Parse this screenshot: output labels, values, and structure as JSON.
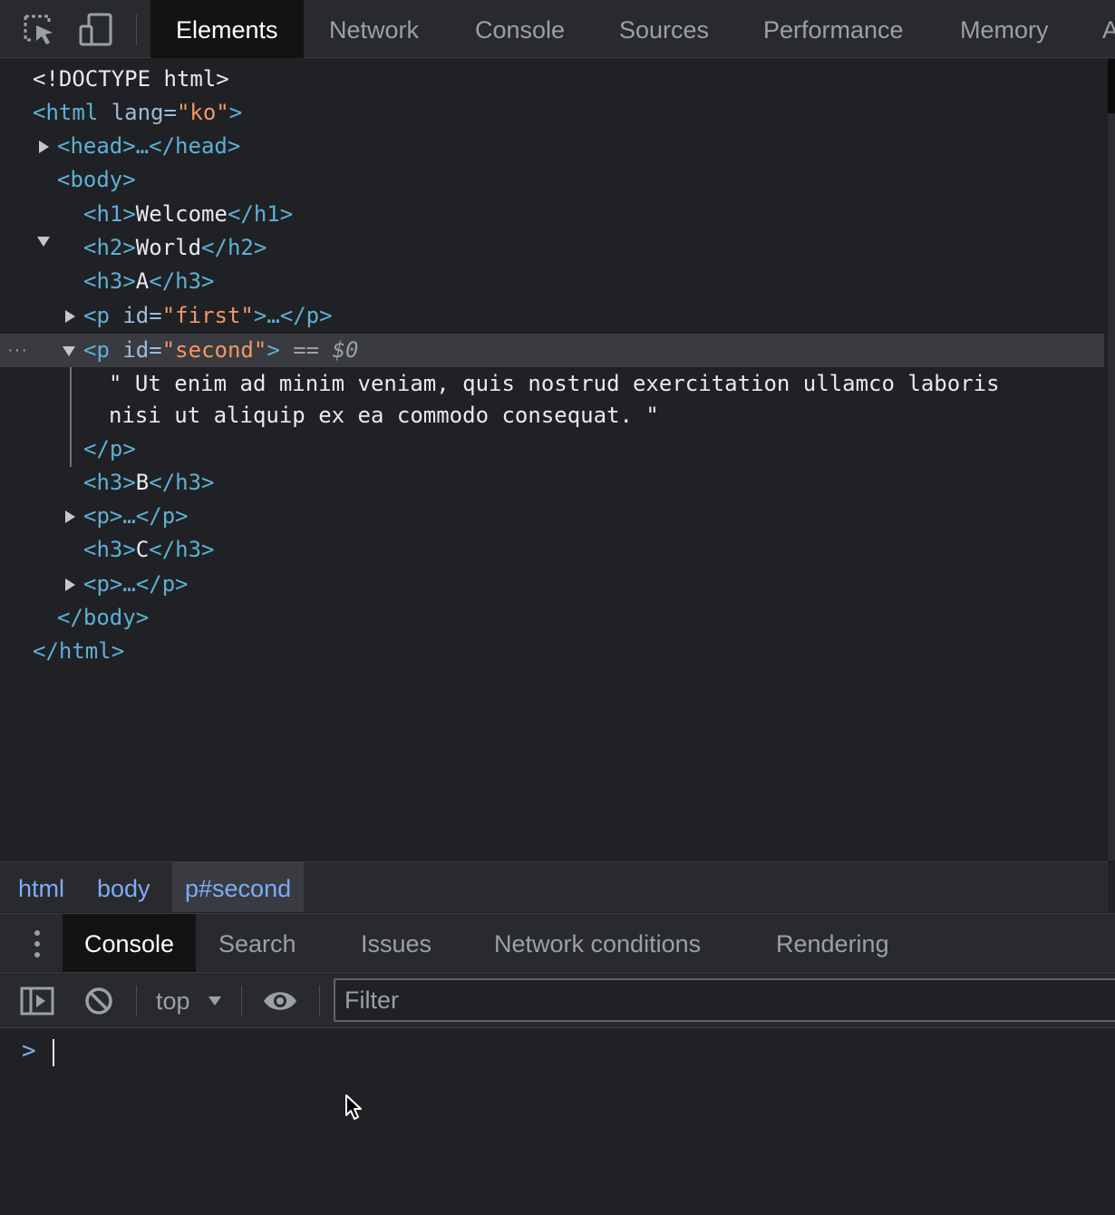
{
  "toolbar": {
    "tabs": [
      "Elements",
      "Network",
      "Console",
      "Sources",
      "Performance",
      "Memory",
      "A"
    ]
  },
  "tree": {
    "doctype": "<!DOCTYPE html>",
    "html_open_tag": "<html ",
    "html_attr_name": "lang=",
    "html_attr_value": "\"ko\"",
    "html_open_close": ">",
    "head_collapsed": "<head>…</head>",
    "body_open": "<body>",
    "h1_open": "<h1>",
    "h1_text": "Welcome",
    "h1_close": "</h1>",
    "h2_open": "<h2>",
    "h2_text": "World",
    "h2_close": "</h2>",
    "h3a_open": "<h3>",
    "h3a_text": "A",
    "h3a_close": "</h3>",
    "p_first_open": "<p ",
    "p_first_attr": "id=",
    "p_first_val": "\"first\"",
    "p_first_rest": ">…</p>",
    "p_second_open": "<p ",
    "p_second_attr": "id=",
    "p_second_val": "\"second\"",
    "p_second_rest": ">",
    "selected_marker": " == $0",
    "text_line_1": "\" Ut enim ad minim veniam, quis nostrud exercitation ullamco laboris",
    "text_line_2": "nisi ut aliquip ex ea commodo consequat. \"",
    "p_close": "</p>",
    "h3b_open": "<h3>",
    "h3b_text": "B",
    "h3b_close": "</h3>",
    "p_collapsed_1": "<p>…</p>",
    "h3c_open": "<h3>",
    "h3c_text": "C",
    "h3c_close": "</h3>",
    "p_collapsed_2": "<p>…</p>",
    "body_close": "</body>",
    "html_close": "</html>",
    "row_dots": "···"
  },
  "breadcrumb": [
    "html",
    "body",
    "p#second"
  ],
  "drawer": {
    "tabs": [
      "Console",
      "Search",
      "Issues",
      "Network conditions",
      "Rendering"
    ]
  },
  "console": {
    "context": "top",
    "filter_placeholder": "Filter",
    "prompt": ">"
  },
  "colors": {
    "background": "#202124",
    "toolbar": "#292a2d",
    "tag": "#5db0d7",
    "attr_value": "#f29766",
    "selected_row": "#393b40",
    "link": "#7cacf8"
  }
}
